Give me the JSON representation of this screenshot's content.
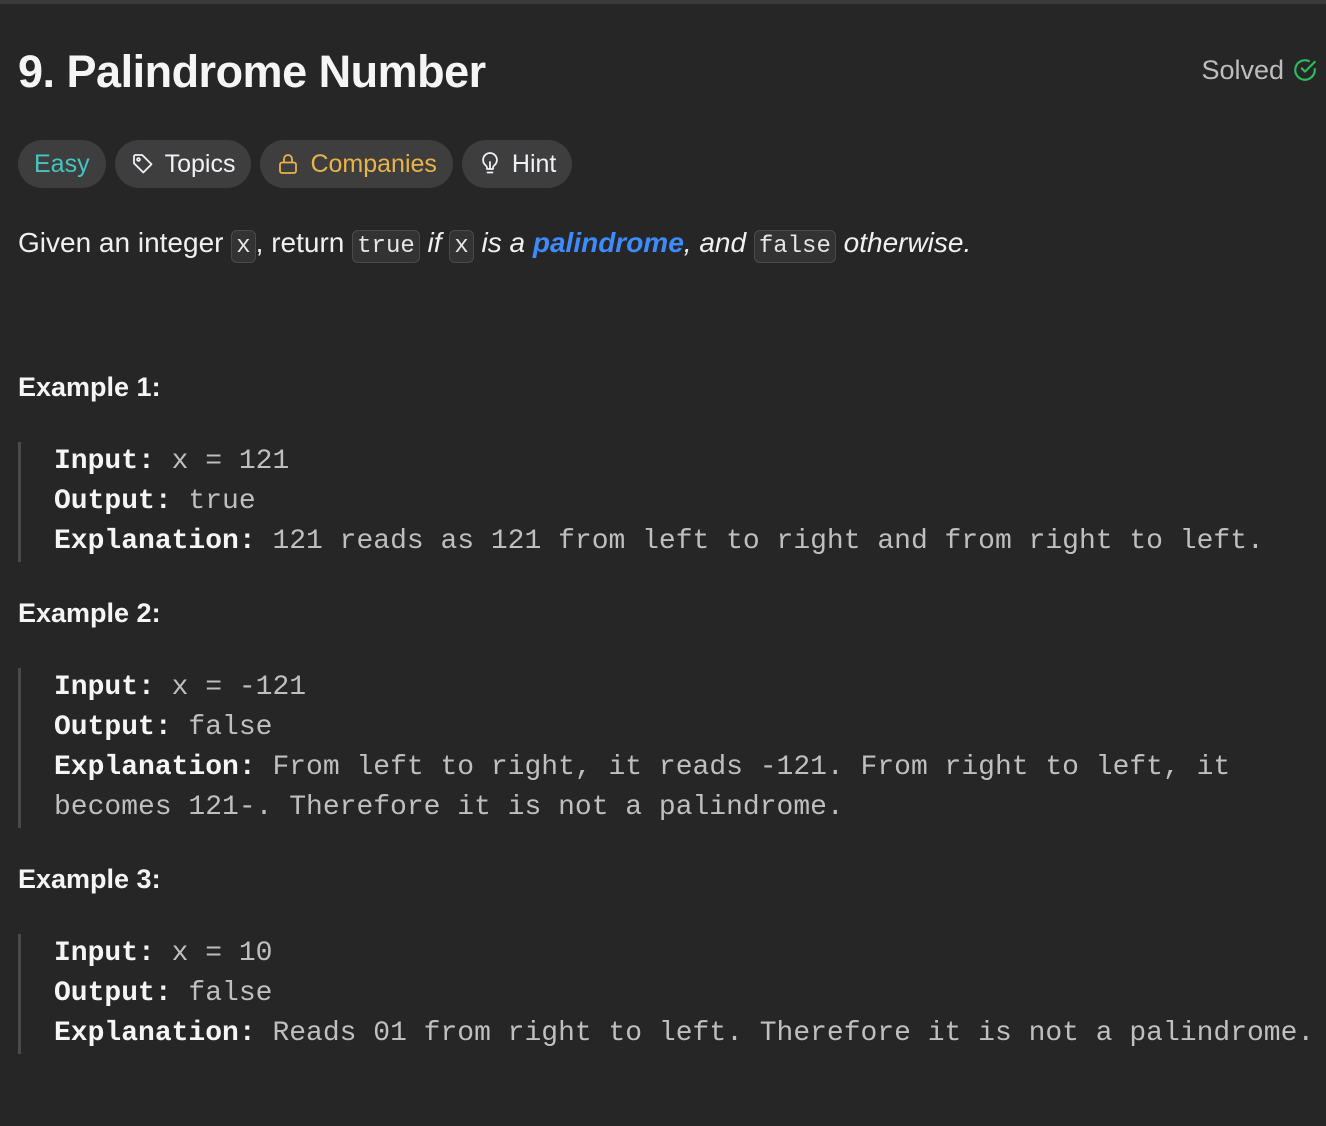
{
  "problem": {
    "title": "9. Palindrome Number",
    "status": "Solved",
    "tags": {
      "difficulty": "Easy",
      "topics": "Topics",
      "companies": "Companies",
      "hint": "Hint"
    },
    "description": {
      "p1": "Given an integer ",
      "code_x": "x",
      "p2": ", return ",
      "code_true": "true",
      "p3": " if ",
      "p4": " is a ",
      "link": "palindrome",
      "p5": ", and ",
      "code_false": "false",
      "p6": " otherwise."
    }
  },
  "examples": [
    {
      "title": "Example 1:",
      "input_label": "Input:",
      "input": " x = 121",
      "output_label": "Output:",
      "output": " true",
      "explanation_label": "Explanation:",
      "explanation_line1": " 121 reads as 121 from left to right and from right to left.",
      "explanation_line2": ""
    },
    {
      "title": "Example 2:",
      "input_label": "Input:",
      "input": " x = -121",
      "output_label": "Output:",
      "output": " false",
      "explanation_label": "Explanation:",
      "explanation_line1": " From left to right, it reads -121. From right to left, it",
      "explanation_line2": "becomes 121-. Therefore it is not a palindrome."
    },
    {
      "title": "Example 3:",
      "input_label": "Input:",
      "input": " x = 10",
      "output_label": "Output:",
      "output": " false",
      "explanation_label": "Explanation:",
      "explanation_line1": " Reads 01 from right to left. Therefore it is not a palindrome.",
      "explanation_line2": ""
    }
  ],
  "colors": {
    "background": "#262626",
    "easy": "#46c6c2",
    "companies": "#e8b44a",
    "solved_check": "#2cbb5d",
    "link": "#3d8bfd"
  }
}
